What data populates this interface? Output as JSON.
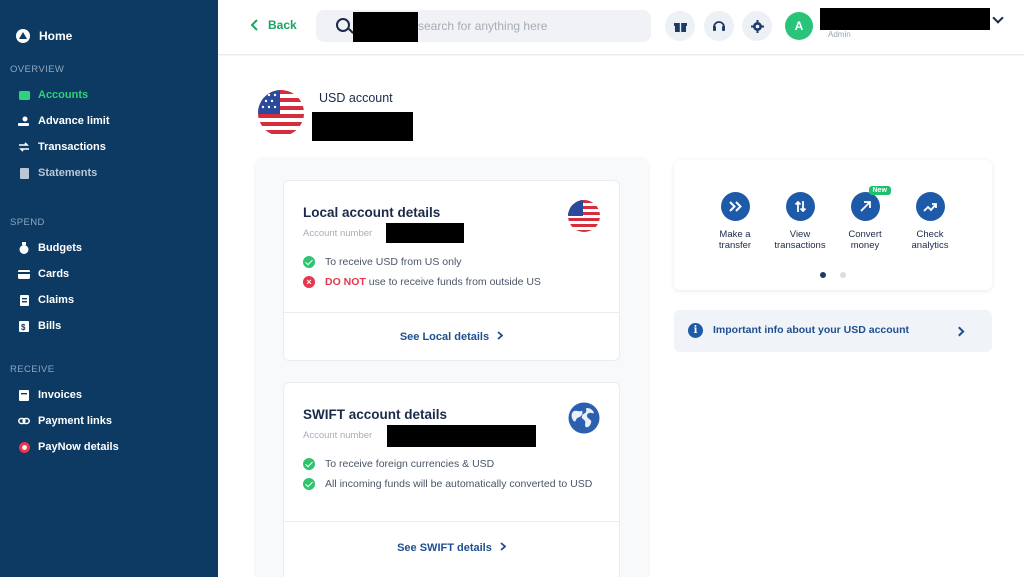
{
  "sidebar": {
    "home": "Home",
    "sections": {
      "overview": "OVERVIEW",
      "spend": "SPEND",
      "receive": "RECEIVE"
    },
    "items": [
      {
        "label": "Accounts",
        "icon": "wallet-icon"
      },
      {
        "label": "Advance limit",
        "icon": "hand-coin-icon"
      },
      {
        "label": "Transactions",
        "icon": "swap-icon"
      },
      {
        "label": "Statements",
        "icon": "document-icon"
      },
      {
        "label": "Budgets",
        "icon": "money-bag-icon"
      },
      {
        "label": "Cards",
        "icon": "card-icon"
      },
      {
        "label": "Claims",
        "icon": "receipt-icon"
      },
      {
        "label": "Bills",
        "icon": "bill-icon"
      },
      {
        "label": "Invoices",
        "icon": "invoice-icon"
      },
      {
        "label": "Payment links",
        "icon": "link-icon"
      },
      {
        "label": "PayNow details",
        "icon": "paynow-icon"
      }
    ]
  },
  "header": {
    "back_label": "Back",
    "search_placeholder": "search for anything here",
    "user_role": "Admin",
    "avatar_initial": "A"
  },
  "account": {
    "title": "USD account"
  },
  "local": {
    "title": "Local account details",
    "number_label": "Account number",
    "check1": "To receive USD from US only",
    "warn_bold": "DO NOT",
    "warn_rest": "use to receive funds from outside US",
    "link": "See Local details"
  },
  "swift": {
    "title": "SWIFT account details",
    "number_label": "Account number",
    "check1": "To receive foreign currencies & USD",
    "check2": "All incoming funds will be automatically converted to USD",
    "link": "See SWIFT details"
  },
  "actions": [
    {
      "line1": "Make a",
      "line2": "transfer",
      "icon": "double-chevron-right-icon"
    },
    {
      "line1": "View",
      "line2": "transactions",
      "icon": "up-down-arrows-icon"
    },
    {
      "line1": "Convert",
      "line2": "money",
      "icon": "convert-icon",
      "badge": "New"
    },
    {
      "line1": "Check",
      "line2": "analytics",
      "icon": "trend-up-icon"
    }
  ],
  "info_bar": "Important info about your USD account",
  "colors": {
    "sidebar_bg": "#0c3a63",
    "accent_green": "#2fd27a",
    "primary_blue": "#1d5aa8",
    "danger_red": "#e5384b"
  }
}
